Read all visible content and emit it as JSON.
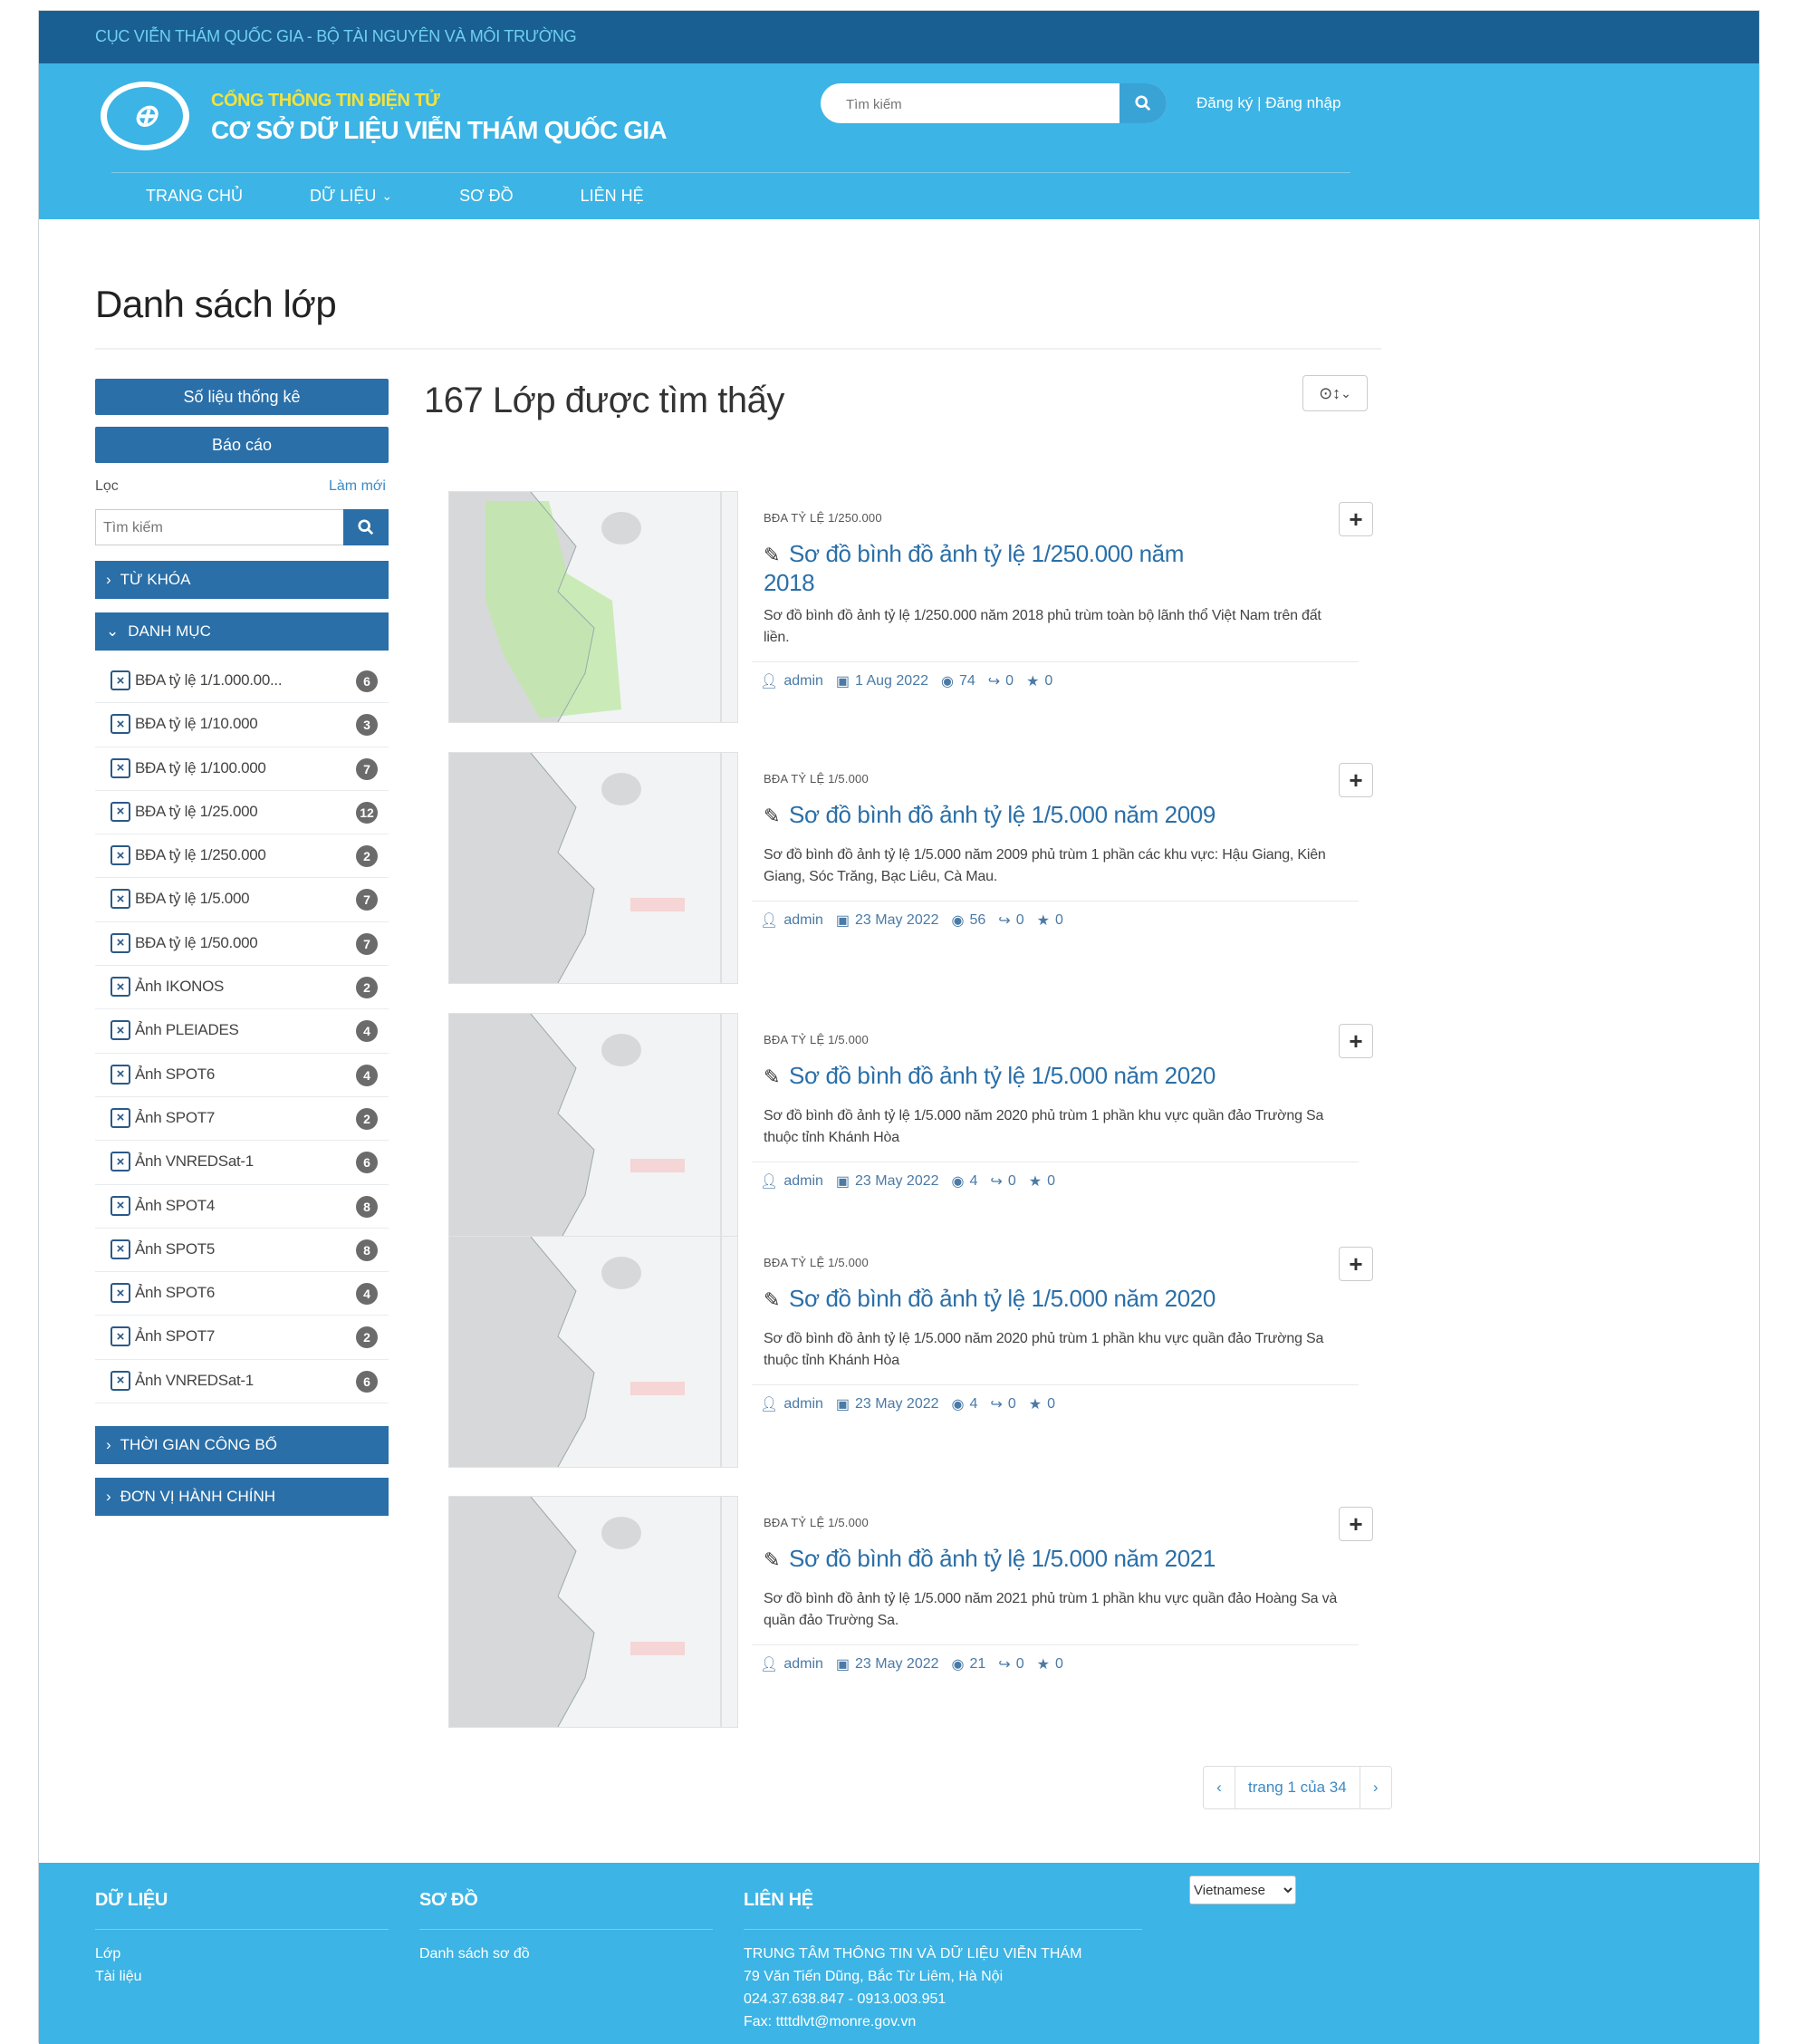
{
  "topbar": {
    "agency": "CỤC VIỄN THÁM QUỐC GIA - BỘ TÀI NGUYÊN VÀ MÔI TRƯỜNG"
  },
  "header": {
    "portal_sub": "CỔNG THÔNG TIN ĐIỆN TỬ",
    "portal_title": "CƠ SỞ DỮ LIỆU VIỄN THÁM QUỐC GIA",
    "search_placeholder": "Tìm kiếm",
    "auth": "Đăng ký | Đăng nhập",
    "nav": [
      "TRANG CHỦ",
      "DỮ LIỆU",
      "SƠ ĐỒ",
      "LIÊN HỆ"
    ]
  },
  "page": {
    "title": "Danh sách lớp"
  },
  "sidebar": {
    "stats_button": "Số liệu thống kê",
    "report_button": "Báo cáo",
    "filter_label": "Lọc",
    "reset_label": "Làm mới",
    "search_placeholder": "Tìm kiếm",
    "facet_keyword": "TỪ KHÓA",
    "facet_category": "DANH MỤC",
    "facet_time": "THỜI GIAN CÔNG BỐ",
    "facet_admin": "ĐƠN VỊ HÀNH CHÍNH",
    "categories": [
      {
        "label": "BĐA tỷ lệ 1/1.000.00...",
        "count": "6"
      },
      {
        "label": "BĐA tỷ lệ 1/10.000",
        "count": "3"
      },
      {
        "label": "BĐA tỷ lệ 1/100.000",
        "count": "7"
      },
      {
        "label": "BĐA tỷ lệ 1/25.000",
        "count": "12"
      },
      {
        "label": "BĐA tỷ lệ 1/250.000",
        "count": "2"
      },
      {
        "label": "BĐA tỷ lệ 1/5.000",
        "count": "7"
      },
      {
        "label": "BĐA tỷ lệ 1/50.000",
        "count": "7"
      },
      {
        "label": "Ảnh IKONOS",
        "count": "2"
      },
      {
        "label": "Ảnh PLEIADES",
        "count": "4"
      },
      {
        "label": "Ảnh SPOT6",
        "count": "4"
      },
      {
        "label": "Ảnh SPOT7",
        "count": "2"
      },
      {
        "label": "Ảnh VNREDSat-1",
        "count": "6"
      },
      {
        "label": "Ảnh SPOT4",
        "count": "8"
      },
      {
        "label": "Ảnh SPOT5",
        "count": "8"
      },
      {
        "label": "Ảnh SPOT6",
        "count": "4"
      },
      {
        "label": "Ảnh SPOT7",
        "count": "2"
      },
      {
        "label": "Ảnh VNREDSat-1",
        "count": "6"
      }
    ]
  },
  "results": {
    "found": "167 Lớp được tìm thấy",
    "items": [
      {
        "category": "BĐA TỶ LỆ 1/250.000",
        "title": "Sơ đồ bình đồ ảnh tỷ lệ 1/250.000 năm 2018",
        "description": "Sơ đồ bình đồ ảnh tỷ lệ 1/250.000 năm 2018 phủ trùm toàn bộ lãnh thổ Việt Nam trên đất liền.",
        "author": "admin",
        "date": "1 Aug 2022",
        "views": "74",
        "shares": "0",
        "stars": "0"
      },
      {
        "category": "BĐA TỶ LỆ 1/5.000",
        "title": "Sơ đồ bình đồ ảnh tỷ lệ 1/5.000 năm 2009",
        "description": "Sơ đồ bình đồ ảnh tỷ lệ 1/5.000 năm 2009 phủ trùm 1 phần các khu vực: Hậu Giang, Kiên Giang, Sóc Trăng, Bạc Liêu, Cà Mau.",
        "author": "admin",
        "date": "23 May 2022",
        "views": "56",
        "shares": "0",
        "stars": "0"
      },
      {
        "category": "BĐA TỶ LỆ 1/5.000",
        "title": "Sơ đồ bình đồ ảnh tỷ lệ 1/5.000 năm 2020",
        "description": "Sơ đồ bình đồ ảnh tỷ lệ 1/5.000 năm 2020 phủ trùm 1 phần khu vực quần đảo Trường Sa thuộc tỉnh Khánh Hòa",
        "author": "admin",
        "date": "23 May 2022",
        "views": "4",
        "shares": "0",
        "stars": "0"
      },
      {
        "category": "BĐA TỶ LỆ 1/5.000",
        "title": "Sơ đồ bình đồ ảnh tỷ lệ 1/5.000 năm 2020",
        "description": "Sơ đồ bình đồ ảnh tỷ lệ 1/5.000 năm 2020 phủ trùm 1 phần khu vực quần đảo Trường Sa thuộc tỉnh Khánh Hòa",
        "author": "admin",
        "date": "23 May 2022",
        "views": "4",
        "shares": "0",
        "stars": "0"
      },
      {
        "category": "BĐA TỶ LỆ 1/5.000",
        "title": "Sơ đồ bình đồ ảnh tỷ lệ 1/5.000 năm 2021",
        "description": "Sơ đồ bình đồ ảnh tỷ lệ 1/5.000 năm 2021 phủ trùm 1 phần khu vực quần đảo Hoàng Sa và quần đảo Trường Sa.",
        "author": "admin",
        "date": "23 May 2022",
        "views": "21",
        "shares": "0",
        "stars": "0"
      }
    ],
    "pagination": {
      "label": "trang 1 của 34"
    }
  },
  "footer": {
    "data_heading": "DỮ LIỆU",
    "data_links": [
      "Lớp",
      "Tài liệu"
    ],
    "map_heading": "SƠ ĐỒ",
    "map_links": [
      "Danh sách sơ đồ"
    ],
    "contact_heading": "LIÊN HỆ",
    "contact_lines": [
      "TRUNG TÂM THÔNG TIN VÀ DỮ LIỆU VIỄN THÁM",
      "79 Văn Tiến Dũng, Bắc Từ Liêm, Hà Nội",
      "024.37.638.847 - 0913.003.951",
      "Fax: ttttdlvt@monre.gov.vn"
    ],
    "language": "Vietnamese"
  },
  "colors": {
    "topbar": "#1a5f91",
    "header": "#3cb4e5",
    "accent": "#2a6fa8",
    "subtitle": "#f3e23b"
  }
}
